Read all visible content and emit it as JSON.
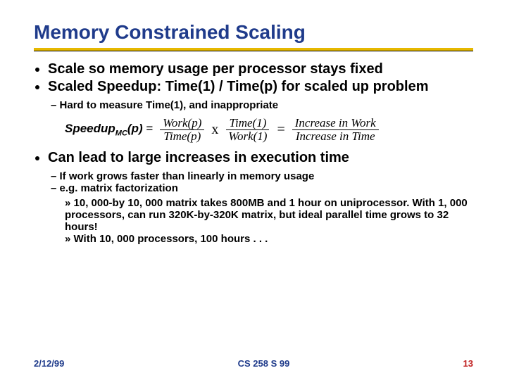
{
  "title": "Memory Constrained Scaling",
  "bullets": {
    "b1": "Scale so memory usage per processor stays fixed",
    "b2": "Scaled Speedup: Time(1) / Time(p) for scaled up problem",
    "b3": "Can lead to large increases in execution time",
    "sub1": "Hard to measure Time(1), and inappropriate",
    "sub3a": "If work grows faster than linearly in memory usage",
    "sub3b": "e.g. matrix factorization",
    "sub3b1": "10, 000-by 10, 000 matrix takes 800MB and 1 hour on uniprocessor.  With 1, 000 processors,  can run 320K-by-320K matrix, but ideal parallel time grows to 32 hours!",
    "sub3b2": "With 10, 000 processors, 100 hours . . ."
  },
  "formula": {
    "lhs_prefix": "Speedup",
    "lhs_sub": "MC",
    "lhs_paren": "(p) ",
    "eq": "=",
    "f1_num": "Work(p)",
    "f1_den": "Time(p)",
    "times": "x",
    "f2_num": "Time(1)",
    "f2_den": "Work(1)",
    "eq2": "=",
    "f3_num": "Increase in Work",
    "f3_den": "Increase in Time"
  },
  "footer": {
    "date": "2/12/99",
    "course": "CS 258 S 99",
    "page": "13"
  }
}
